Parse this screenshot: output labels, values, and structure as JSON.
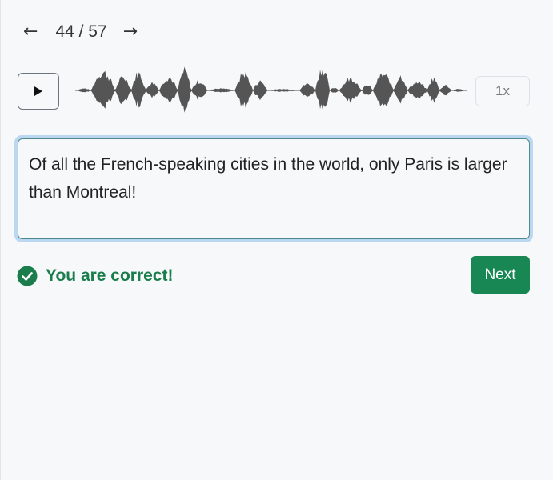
{
  "nav": {
    "prev_icon": "arrow-left-icon",
    "next_icon": "arrow-right-icon",
    "current": 44,
    "total": 57,
    "counter_text": "44 / 57"
  },
  "player": {
    "play_icon": "play-icon",
    "speed_label": "1x"
  },
  "answer": {
    "text": "Of all the French-speaking cities in the world, only Paris is larger than Montreal!"
  },
  "result": {
    "icon": "check-circle-icon",
    "message": "You are correct!"
  },
  "actions": {
    "next_label": "Next"
  },
  "colors": {
    "success": "#198754",
    "waveform": "#555555",
    "focus_ring": "#bcd7f1"
  }
}
